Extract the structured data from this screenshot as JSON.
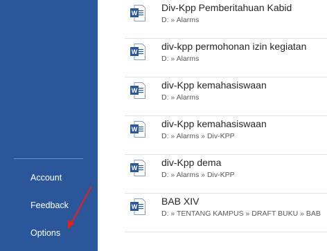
{
  "sidebar": {
    "items": [
      {
        "label": "Account"
      },
      {
        "label": "Feedback"
      },
      {
        "label": "Options"
      }
    ]
  },
  "recent_files": [
    {
      "name": "Div-Kpp Pemberitahuan Kabid",
      "path": "D: » Alarms",
      "icon": "word-document-icon"
    },
    {
      "name": "div-kpp permohonan izin kegiatan",
      "path": "D: » Alarms",
      "icon": "word-document-icon"
    },
    {
      "name": "div-Kpp kemahasiswaan",
      "path": "D: » Alarms",
      "icon": "word-document-icon"
    },
    {
      "name": "div-Kpp kemahasiswaan",
      "path": "D: » Alarms » Div-KPP",
      "icon": "word-document-icon"
    },
    {
      "name": "div-Kpp dema",
      "path": "D: » Alarms » Div-KPP",
      "icon": "word-document-icon"
    },
    {
      "name": "BAB XIV",
      "path": "D: » TENTANG KAMPUS » DRAFT BUKU » BAB",
      "icon": "word-document-icon"
    }
  ],
  "colors": {
    "sidebar_bg": "#2b579a",
    "word_blue": "#2b579a",
    "annotation_red": "#e3231b"
  }
}
